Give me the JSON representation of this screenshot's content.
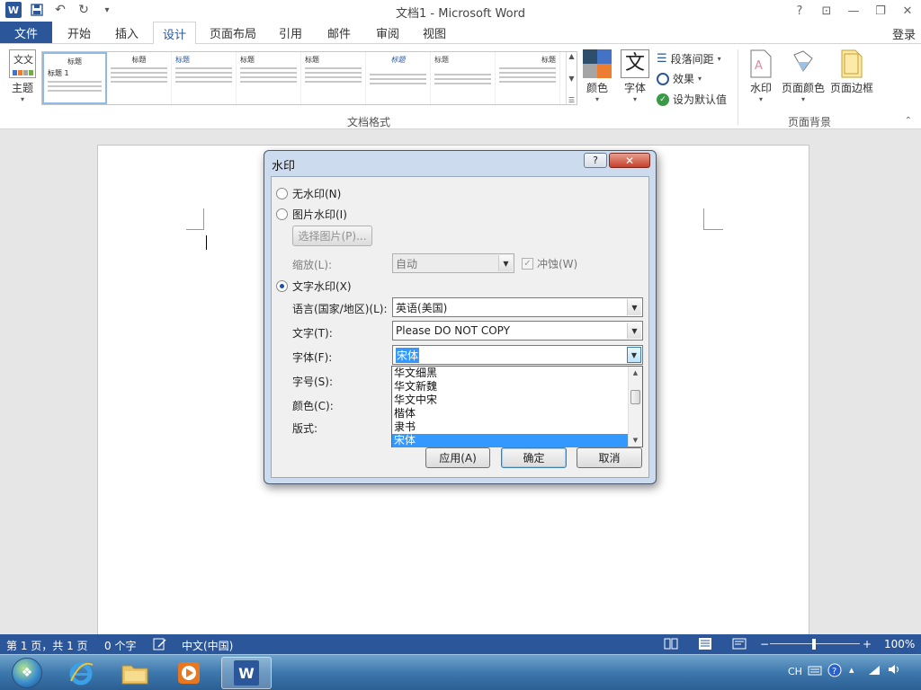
{
  "window": {
    "title": "文档1 - Microsoft Word",
    "controls": {
      "help": "?",
      "ribbon_display": "⊡",
      "minimize": "—",
      "restore": "❐",
      "close": "✕"
    }
  },
  "quick_access": {
    "undo": "↶",
    "redo": "↻",
    "customize": "▾"
  },
  "ribbon": {
    "file_tab": "文件",
    "tabs": [
      "开始",
      "插入",
      "设计",
      "页面布局",
      "引用",
      "邮件",
      "审阅",
      "视图"
    ],
    "active_tab": "设计",
    "login": "登录",
    "themes_label": "主题",
    "style_gallery": {
      "headings": [
        "标题",
        "标题",
        "标题",
        "标题",
        "标题",
        "标题",
        "标题",
        "标题"
      ],
      "first_subtitle": "标题 1"
    },
    "document_formatting_label": "文档格式",
    "colors_label": "颜色",
    "fonts_label": "字体",
    "fonts_glyph": "文",
    "paragraph_spacing_label": "段落间距",
    "effects_label": "效果",
    "set_default_label": "设为默认值",
    "watermark_label": "水印",
    "page_color_label": "页面颜色",
    "page_borders_label": "页面边框",
    "page_background_label": "页面背景"
  },
  "dialog": {
    "title": "水印",
    "help": "?",
    "close": "✕",
    "no_watermark": "无水印(N)",
    "picture_watermark": "图片水印(I)",
    "select_picture": "选择图片(P)...",
    "scale_label": "缩放(L):",
    "scale_value": "自动",
    "washout_label": "冲蚀(W)",
    "text_watermark": "文字水印(X)",
    "language_label": "语言(国家/地区)(L):",
    "language_value": "英语(美国)",
    "text_label": "文字(T):",
    "text_value": "Please DO NOT COPY",
    "font_label": "字体(F):",
    "font_value": "宋体",
    "size_label": "字号(S):",
    "color_label": "颜色(C):",
    "layout_label": "版式:",
    "font_options": [
      "华文细黑",
      "华文新魏",
      "华文中宋",
      "楷体",
      "隶书",
      "宋体"
    ],
    "selected_font": "宋体",
    "apply": "应用(A)",
    "ok": "确定",
    "cancel": "取消"
  },
  "status_bar": {
    "page": "第 1 页，共 1 页",
    "words": "0 个字",
    "language": "中文(中国)",
    "zoom": "100%",
    "zoom_minus": "−",
    "zoom_plus": "+"
  },
  "taskbar": {
    "input_method": "CH",
    "word_label": "W"
  },
  "colors": {
    "accent": "#2b579a",
    "selection": "#3399ff",
    "dialog_frame": "#cddbee",
    "close_button": "#c7402b"
  },
  "icons": [
    "word-logo-icon",
    "save-icon",
    "undo-icon",
    "redo-icon",
    "themes-icon",
    "colors-icon",
    "fonts-icon",
    "paragraph-spacing-icon",
    "effects-icon",
    "checkmark-icon",
    "watermark-icon",
    "page-color-icon",
    "page-borders-icon",
    "start-orb-icon",
    "internet-explorer-icon",
    "file-explorer-icon",
    "media-player-icon",
    "word-icon",
    "keyboard-icon",
    "help-icon",
    "speaker-icon"
  ]
}
